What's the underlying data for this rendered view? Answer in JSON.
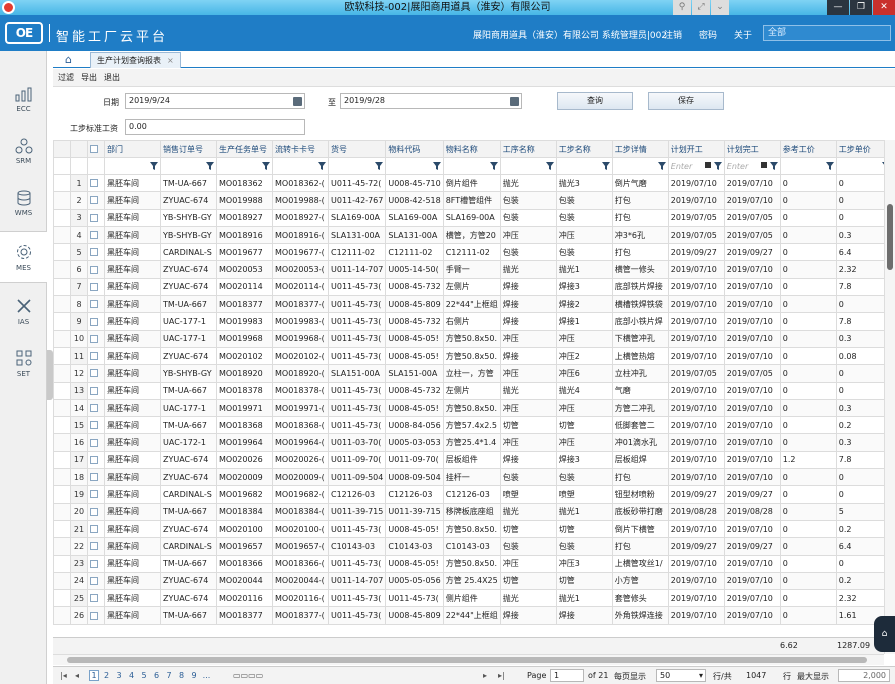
{
  "window": {
    "title": "欧软科技-002|展阳商用道具（淮安）有限公司"
  },
  "header": {
    "logo_text": "OE",
    "platform": "智能工厂云平台",
    "company_user": "展阳商用道具（淮安）有限公司 系统管理员|002",
    "links": [
      "注销",
      "密码",
      "关于"
    ],
    "search_value": "全部"
  },
  "sidebar": [
    {
      "label": "ECC",
      "icon": "chart-icon"
    },
    {
      "label": "SRM",
      "icon": "network-icon"
    },
    {
      "label": "WMS",
      "icon": "database-icon"
    },
    {
      "label": "MES",
      "icon": "gear-icon",
      "active": true
    },
    {
      "label": "IAS",
      "icon": "tools-icon"
    },
    {
      "label": "SET",
      "icon": "grid-settings-icon"
    }
  ],
  "tabs": [
    {
      "label": "生产计划查询报表"
    }
  ],
  "toolbar": [
    "过滤",
    "导出",
    "退出"
  ],
  "form": {
    "date_label": "日期",
    "date_from": "2019/9/24",
    "to_label": "至",
    "date_to": "2019/9/28",
    "query_button": "查询",
    "save_button": "保存",
    "wage_label": "工步标准工资",
    "wage_value": "0.00"
  },
  "table": {
    "columns": [
      "部门",
      "销售订单号",
      "生产任务单号",
      "流转卡卡号",
      "货号",
      "物料代码",
      "物料名称",
      "工序名称",
      "工步名称",
      "工步详情",
      "计划开工",
      "计划完工",
      "参考工价",
      "工步单价"
    ],
    "filter_placeholder": "Enter",
    "rows": [
      [
        "1",
        "黑胚车间",
        "TM-UA-667",
        "MO018362",
        "MO018362-(",
        "U011-45-72(",
        "U008-45-710",
        "倒片组件",
        "抛光",
        "抛光3",
        "倒片气磨",
        "2019/07/10",
        "2019/07/10",
        "0",
        "0"
      ],
      [
        "2",
        "黑胚车间",
        "ZYUAC-674",
        "MO019988",
        "MO019988-(",
        "U011-42-767",
        "U008-42-518",
        "8FT槽管组件",
        "包装",
        "包装",
        "打包",
        "2019/07/10",
        "2019/07/10",
        "0",
        "0"
      ],
      [
        "3",
        "黑胚车间",
        "YB-SHYB-GY",
        "MO018927",
        "MO018927-(",
        "SLA169-00A",
        "SLA169-00A",
        "SLA169-00A",
        "包装",
        "包装",
        "打包",
        "2019/07/05",
        "2019/07/05",
        "0",
        "0"
      ],
      [
        "4",
        "黑胚车间",
        "YB-SHYB-GY",
        "MO018916",
        "MO018916-(",
        "SLA131-00A",
        "SLA131-00A",
        "横管，方管20",
        "冲压",
        "冲压",
        "冲3*6孔",
        "2019/07/05",
        "2019/07/05",
        "0",
        "0.3"
      ],
      [
        "5",
        "黑胚车间",
        "CARDINAL-S",
        "MO019677",
        "MO019677-(",
        "C12111-02",
        "C12111-02",
        "C12111-02",
        "包装",
        "包装",
        "打包",
        "2019/09/27",
        "2019/09/27",
        "0",
        "6.4"
      ],
      [
        "6",
        "黑胚车间",
        "ZYUAC-674",
        "MO020053",
        "MO020053-(",
        "U011-14-707",
        "U005-14-50(",
        "手臂一",
        "抛光",
        "抛光1",
        "横管一修头",
        "2019/07/10",
        "2019/07/10",
        "0",
        "2.32"
      ],
      [
        "7",
        "黑胚车间",
        "ZYUAC-674",
        "MO020114",
        "MO020114-(",
        "U011-45-73(",
        "U008-45-732",
        "左侧片",
        "焊接",
        "焊接3",
        "底部铁片焊接",
        "2019/07/10",
        "2019/07/10",
        "0",
        "7.8"
      ],
      [
        "8",
        "黑胚车间",
        "TM-UA-667",
        "MO018377",
        "MO018377-(",
        "U011-45-73(",
        "U008-45-809",
        "22*44\"上框组",
        "焊接",
        "焊接2",
        "横槽铁焊铁袋",
        "2019/07/10",
        "2019/07/10",
        "0",
        "0"
      ],
      [
        "9",
        "黑胚车间",
        "UAC-177-1",
        "MO019983",
        "MO019983-(",
        "U011-45-73(",
        "U008-45-732",
        "右侧片",
        "焊接",
        "焊接1",
        "底部小铁片焊",
        "2019/07/10",
        "2019/07/10",
        "0",
        "7.8"
      ],
      [
        "10",
        "黑胚车间",
        "UAC-177-1",
        "MO019968",
        "MO019968-(",
        "U011-45-73(",
        "U008-45-05!",
        "方管50.8x50.",
        "冲压",
        "冲压",
        "下横管冲孔",
        "2019/07/10",
        "2019/07/10",
        "0",
        "0.3"
      ],
      [
        "11",
        "黑胚车间",
        "ZYUAC-674",
        "MO020102",
        "MO020102-(",
        "U011-45-73(",
        "U008-45-05!",
        "方管50.8x50.",
        "焊接",
        "冲压2",
        "上横管热熔",
        "2019/07/10",
        "2019/07/10",
        "0",
        "0.08"
      ],
      [
        "12",
        "黑胚车间",
        "YB-SHYB-GY",
        "MO018920",
        "MO018920-(",
        "SLA151-00A",
        "SLA151-00A",
        "立柱一，方管",
        "冲压",
        "冲压6",
        "立柱冲孔",
        "2019/07/05",
        "2019/07/05",
        "0",
        "0"
      ],
      [
        "13",
        "黑胚车间",
        "TM-UA-667",
        "MO018378",
        "MO018378-(",
        "U011-45-73(",
        "U008-45-732",
        "左侧片",
        "抛光",
        "抛光4",
        "气磨",
        "2019/07/10",
        "2019/07/10",
        "0",
        "0"
      ],
      [
        "14",
        "黑胚车间",
        "UAC-177-1",
        "MO019971",
        "MO019971-(",
        "U011-45-73(",
        "U008-45-05!",
        "方管50.8x50.",
        "冲压",
        "冲压",
        "方管二冲孔",
        "2019/07/10",
        "2019/07/10",
        "0",
        "0.3"
      ],
      [
        "15",
        "黑胚车间",
        "TM-UA-667",
        "MO018368",
        "MO018368-(",
        "U011-45-73(",
        "U008-84-056",
        "方管57.4x2.5",
        "切管",
        "切管",
        "低脚套管二",
        "2019/07/10",
        "2019/07/10",
        "0",
        "0.2"
      ],
      [
        "16",
        "黑胚车间",
        "UAC-172-1",
        "MO019964",
        "MO019964-(",
        "U011-03-70(",
        "U005-03-053",
        "方管25.4*1.4",
        "冲压",
        "冲压",
        "冲01滴水孔",
        "2019/07/10",
        "2019/07/10",
        "0",
        "0.3"
      ],
      [
        "17",
        "黑胚车间",
        "ZYUAC-674",
        "MO020026",
        "MO020026-(",
        "U011-09-70(",
        "U011-09-70(",
        "层板组件",
        "焊接",
        "焊接3",
        "层板组焊",
        "2019/07/10",
        "2019/07/10",
        "1.2",
        "7.8"
      ],
      [
        "18",
        "黑胚车间",
        "ZYUAC-674",
        "MO020009",
        "MO020009-(",
        "U011-09-504",
        "U008-09-504",
        "挂杆一",
        "包装",
        "包装",
        "打包",
        "2019/07/10",
        "2019/07/10",
        "0",
        "0"
      ],
      [
        "19",
        "黑胚车间",
        "CARDINAL-S",
        "MO019682",
        "MO019682-(",
        "C12126-03",
        "C12126-03",
        "C12126-03",
        "喷塑",
        "喷塑",
        "钮型材喷粉",
        "2019/09/27",
        "2019/09/27",
        "0",
        "0"
      ],
      [
        "20",
        "黑胚车间",
        "TM-UA-667",
        "MO018384",
        "MO018384-(",
        "U011-39-715",
        "U011-39-715",
        "移牌板底座组",
        "抛光",
        "抛光1",
        "底板砂带打磨",
        "2019/08/28",
        "2019/08/28",
        "0",
        "5"
      ],
      [
        "21",
        "黑胚车间",
        "ZYUAC-674",
        "MO020100",
        "MO020100-(",
        "U011-45-73(",
        "U008-45-05!",
        "方管50.8x50.",
        "切管",
        "切管",
        "倒片下横管",
        "2019/07/10",
        "2019/07/10",
        "0",
        "0.2"
      ],
      [
        "22",
        "黑胚车间",
        "CARDINAL-S",
        "MO019657",
        "MO019657-(",
        "C10143-03",
        "C10143-03",
        "C10143-03",
        "包装",
        "包装",
        "打包",
        "2019/09/27",
        "2019/09/27",
        "0",
        "6.4"
      ],
      [
        "23",
        "黑胚车间",
        "TM-UA-667",
        "MO018366",
        "MO018366-(",
        "U011-45-73(",
        "U008-45-05!",
        "方管50.8x50.",
        "冲压",
        "冲压3",
        "上横管攻丝1/",
        "2019/07/10",
        "2019/07/10",
        "0",
        "0"
      ],
      [
        "24",
        "黑胚车间",
        "ZYUAC-674",
        "MO020044",
        "MO020044-(",
        "U011-14-707",
        "U005-05-056",
        "方管 25.4X25",
        "切管",
        "切管",
        "小方管",
        "2019/07/10",
        "2019/07/10",
        "0",
        "0.2"
      ],
      [
        "25",
        "黑胚车间",
        "ZYUAC-674",
        "MO020116",
        "MO020116-(",
        "U011-45-73(",
        "U011-45-73(",
        "侧片组件",
        "抛光",
        "抛光1",
        "套管修头",
        "2019/07/10",
        "2019/07/10",
        "0",
        "2.32"
      ],
      [
        "26",
        "黑胚车间",
        "TM-UA-667",
        "MO018377",
        "MO018377-(",
        "U011-45-73(",
        "U008-45-809",
        "22*44\"上框组",
        "焊接",
        "焊接",
        "外角铁焊连接",
        "2019/07/10",
        "2019/07/10",
        "0",
        "1.61"
      ]
    ],
    "totals": {
      "ref_price": "6.62",
      "unit_price": "1287.09"
    }
  },
  "pager": {
    "pages": [
      "1",
      "2",
      "3",
      "4",
      "5",
      "6",
      "7",
      "8",
      "9",
      "..."
    ],
    "page_label": "Page",
    "page_value": "1",
    "of_label": "of 21",
    "per_page_label": "每页显示",
    "per_page_value": "50",
    "rows_label": "行/共",
    "total_rows": "1047",
    "row_label": "行",
    "max_label": "最大显示",
    "max_value": "2,000"
  }
}
